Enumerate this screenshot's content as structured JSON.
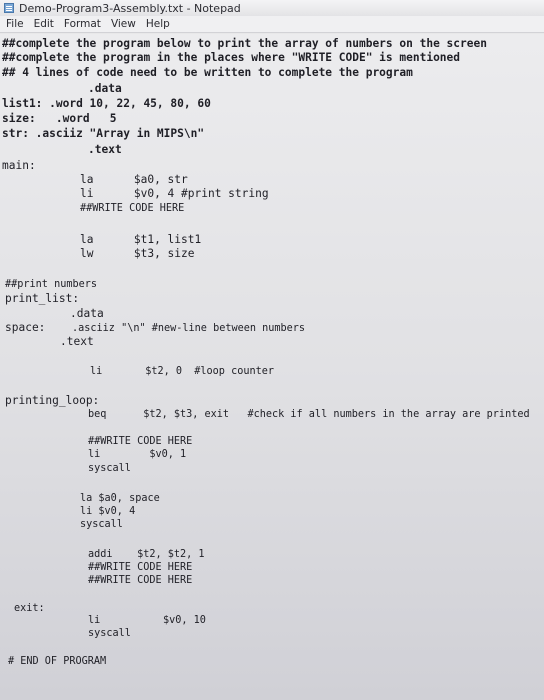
{
  "window": {
    "title": "Demo-Program3-Assembly.txt - Notepad"
  },
  "menu": {
    "file": "File",
    "edit": "Edit",
    "format": "Format",
    "view": "View",
    "help": "Help"
  },
  "code": {
    "l01": "##complete the program below to print the array of numbers on the screen",
    "l02": "##complete the program in the places where \"WRITE CODE\" is mentioned",
    "l03": "## 4 lines of code need to be written to complete the program",
    "l04": ".data",
    "l05": "list1: .word 10, 22, 45, 80, 60",
    "l06": "size:   .word   5",
    "l07": "str: .asciiz \"Array in MIPS\\n\"",
    "l08": ".text",
    "l09": "main:",
    "l10": "la      $a0, str",
    "l11": "li      $v0, 4 #print string",
    "l12": "##WRITE CODE HERE",
    "l13": "la      $t1, list1",
    "l14": "lw      $t3, size",
    "l15": "##print numbers",
    "l16": "print_list:",
    "l17": ".data",
    "l18": "space:",
    "l19": ".asciiz \"\\n\" #new-line between numbers",
    "l20": ".text",
    "l21": "li       $t2, 0  #loop counter",
    "l22": "printing_loop:",
    "l23": "beq      $t2, $t3, exit   #check if all numbers in the array are printed",
    "l24": "##WRITE CODE HERE",
    "l25": "li        $v0, 1",
    "l26": "syscall",
    "l27": "la $a0, space",
    "l28": "li $v0, 4",
    "l29": "syscall",
    "l30": "addi    $t2, $t2, 1",
    "l31": "##WRITE CODE HERE",
    "l32": "##WRITE CODE HERE",
    "l33": "exit:",
    "l34": "li",
    "l35": "$v0, 10",
    "l36": "syscall",
    "l37": "# END OF PROGRAM"
  }
}
